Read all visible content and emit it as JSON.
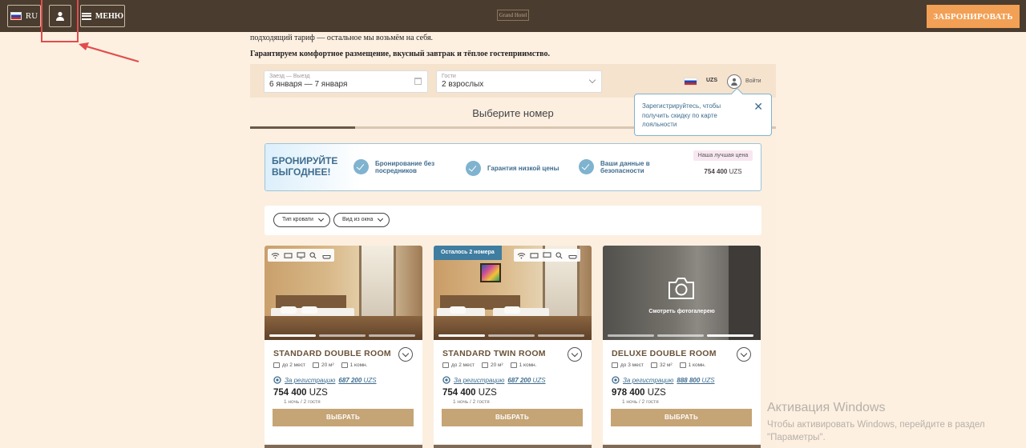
{
  "topbar": {
    "lang_label": "RU",
    "menu_label": "МЕНЮ",
    "logo_text": "Grand Hotel",
    "book_label": "ЗАБРОНИРОВАТЬ"
  },
  "intro": {
    "line1": "подходящий тариф — остальное мы возьмём на себя.",
    "line2": "Гарантируем комфортное размещение, вкусный завтрак и тёплое гостеприимство."
  },
  "search": {
    "dates_label": "Заезд — Выезд",
    "dates_value": "6 января — 7 января",
    "guests_label": "Гости",
    "guests_value": "2 взрослых",
    "currency": "UZS",
    "login": "Войти"
  },
  "tooltip": {
    "text": "Зарегистрируйтесь, чтобы получить скидку по карте лояльности",
    "close": "✕"
  },
  "section_title": "Выберите номер",
  "promo": {
    "headline_1": "БРОНИРУЙТЕ",
    "headline_2": "ВЫГОДНЕЕ!",
    "items": [
      {
        "line1": "Бронирование без",
        "line2": "посредников"
      },
      {
        "line1": "Гарантия низкой цены",
        "line2": ""
      },
      {
        "line1": "Ваши данные в",
        "line2": "безопасности"
      }
    ],
    "best_label": "Наша лучшая цена",
    "best_value": "754 400",
    "best_currency": "UZS"
  },
  "filters": [
    {
      "label": "Тип кровати"
    },
    {
      "label": "Вид из окна"
    }
  ],
  "rooms": [
    {
      "name": "STANDARD DOUBLE ROOM",
      "guests": "до 2 мест",
      "area": "20 м²",
      "rooms": "1 комн.",
      "reg_label": "За регистрацию",
      "reg_price": "687 200",
      "reg_currency": "UZS",
      "price": "754 400",
      "currency": "UZS",
      "nights": "1 ночь / 2 гостя",
      "button": "ВЫБРАТЬ",
      "badge": ""
    },
    {
      "name": "STANDARD TWIN ROOM",
      "guests": "до 2 мест",
      "area": "20 м²",
      "rooms": "1 комн.",
      "reg_label": "За регистрацию",
      "reg_price": "687 200",
      "reg_currency": "UZS",
      "price": "754 400",
      "currency": "UZS",
      "nights": "1 ночь / 2 гостя",
      "button": "ВЫБРАТЬ",
      "badge": "Осталось 2 номера"
    },
    {
      "name": "DELUXE DOUBLE ROOM",
      "guests": "до 3 мест",
      "area": "32 м²",
      "rooms": "1 комн.",
      "reg_label": "За регистрацию",
      "reg_price": "888 800",
      "reg_currency": "UZS",
      "price": "978 400",
      "currency": "UZS",
      "nights": "1 ночь / 2 гостя",
      "button": "ВЫБРАТЬ",
      "badge": "",
      "gallery_label": "Смотреть фотогалерею"
    }
  ],
  "watermark": {
    "title": "Активация Windows",
    "text": "Чтобы активировать Windows, перейдите в раздел \"Параметры\"."
  },
  "colors": {
    "topbar": "#4a3c2e",
    "accent": "#f2a055",
    "gold": "#c5a475",
    "blue": "#3e6c8e",
    "annotation": "#e24c4c"
  }
}
